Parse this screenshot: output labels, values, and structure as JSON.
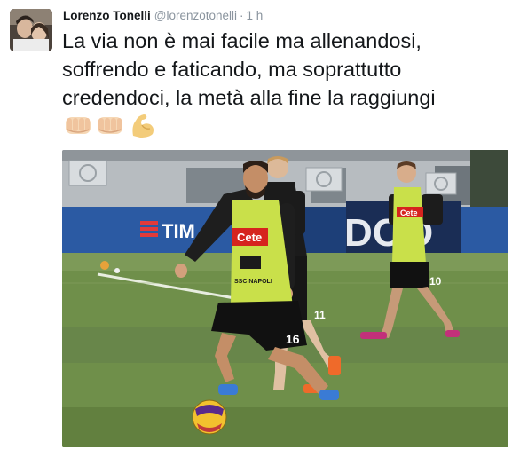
{
  "tweet": {
    "author_name": "Lorenzo Tonelli",
    "handle": "@lorenzotonelli",
    "separator": "·",
    "time": "1 h",
    "text": "La via non è mai facile ma allenandosi, soffrendo e faticando, ma soprattutto credendoci, la metà alla fine la raggiungi",
    "emojis": [
      "fist-icon",
      "fist-icon",
      "flexed-biceps-icon"
    ]
  },
  "photo": {
    "banner_text": "TIM",
    "banner_text_right": "DOO",
    "shirt_sponsor": "Cete",
    "shirt_text": "SSC NAPOLI",
    "player_numbers": [
      "16",
      "11",
      "10"
    ]
  },
  "colors": {
    "text": "#14171a",
    "meta": "#8a949e",
    "pitch": "#6f8f4a",
    "bib": "#c9e04a",
    "banner": "#2b5aa3"
  }
}
